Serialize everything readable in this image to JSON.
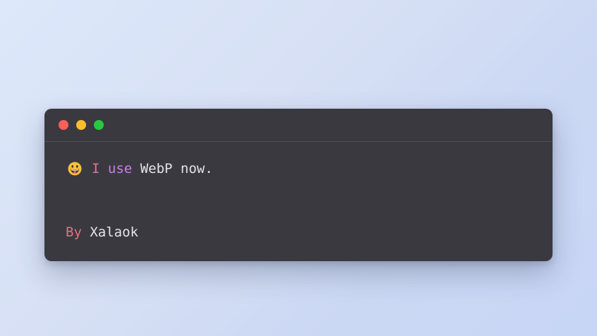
{
  "window": {
    "controls": [
      {
        "name": "close",
        "color": "#fe5f57"
      },
      {
        "name": "minimize",
        "color": "#febc2e"
      },
      {
        "name": "maximize",
        "color": "#28c840"
      }
    ]
  },
  "code": {
    "line1": {
      "emoji_icon": "grinning-face-with-tongue-icon",
      "word1": "I",
      "word2": "use",
      "rest": "WebP now."
    },
    "line2": {
      "keyword": "By",
      "name": "Xalaok"
    }
  },
  "colors": {
    "window_bg": "#3a3940",
    "token_pink": "#e8739a",
    "token_violet": "#c581e8",
    "token_red": "#e2727f",
    "text": "#e4e2ea"
  }
}
